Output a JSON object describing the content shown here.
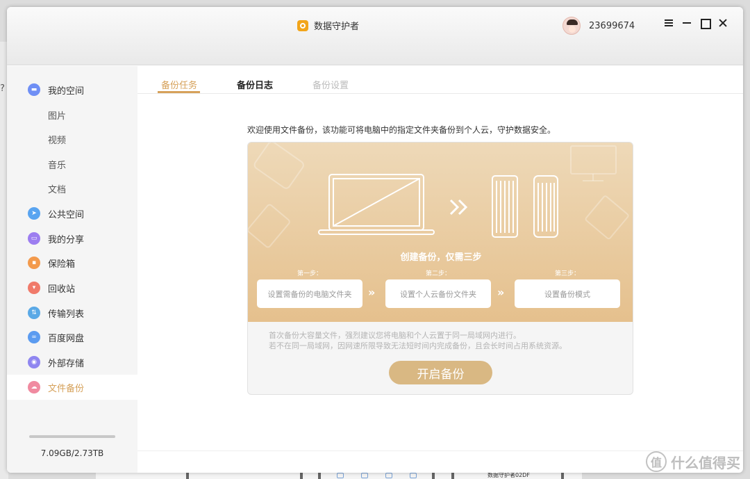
{
  "window": {
    "app_title": "数据守护者",
    "user_id": "23699674"
  },
  "sidebar": {
    "items": [
      {
        "label": "我的空间",
        "icon": "folder-icon",
        "color": "#6f8ff5"
      },
      {
        "label": "图片"
      },
      {
        "label": "视频"
      },
      {
        "label": "音乐"
      },
      {
        "label": "文档"
      },
      {
        "label": "公共空间",
        "icon": "send-icon",
        "color": "#59a4f0"
      },
      {
        "label": "我的分享",
        "icon": "share-icon",
        "color": "#9c7df0"
      },
      {
        "label": "保险箱",
        "icon": "safe-icon",
        "color": "#f39a4c"
      },
      {
        "label": "回收站",
        "icon": "trash-icon",
        "color": "#f07a6a"
      },
      {
        "label": "传输列表",
        "icon": "transfer-icon",
        "color": "#5aa9e6"
      },
      {
        "label": "百度网盘",
        "icon": "cloud-icon",
        "color": "#5b9bf0"
      },
      {
        "label": "外部存储",
        "icon": "usb-icon",
        "color": "#8f86f0"
      },
      {
        "label": "文件备份",
        "icon": "backup-icon",
        "color": "#f08aa0"
      }
    ],
    "storage": {
      "text": "7.09GB/2.73TB",
      "used_fraction": 0.0025
    }
  },
  "tabs": [
    {
      "label": "备份任务"
    },
    {
      "label": "备份日志"
    },
    {
      "label": "备份设置"
    }
  ],
  "main": {
    "welcome": "欢迎使用文件备份，该功能可将电脑中的指定文件夹备份到个人云，守护数据安全。",
    "hero_title": "创建备份，仅需三步",
    "steps": [
      {
        "label": "第一步：",
        "button": "设置需备份的电脑文件夹"
      },
      {
        "label": "第二步：",
        "button": "设置个人云备份文件夹"
      },
      {
        "label": "第三步：",
        "button": "设置备份模式"
      }
    ],
    "notice_line1": "首次备份大容量文件，强烈建议您将电脑和个人云置于同一局域网内进行。",
    "notice_line2": "若不在同一局域网，因网速所限导致无法短时间内完成备份，且会长时间占用系统资源。",
    "start_button": "开启备份"
  },
  "background": {
    "side_char": "?",
    "taskbar_text": "数据守护者02DF",
    "watermark_text": "什么值得买",
    "watermark_symbol": "值"
  },
  "colors": {
    "accent": "#d6a15a",
    "hero_top": "#eed9b8",
    "hero_bottom": "#e5c08d",
    "start_button": "#d9b883"
  }
}
